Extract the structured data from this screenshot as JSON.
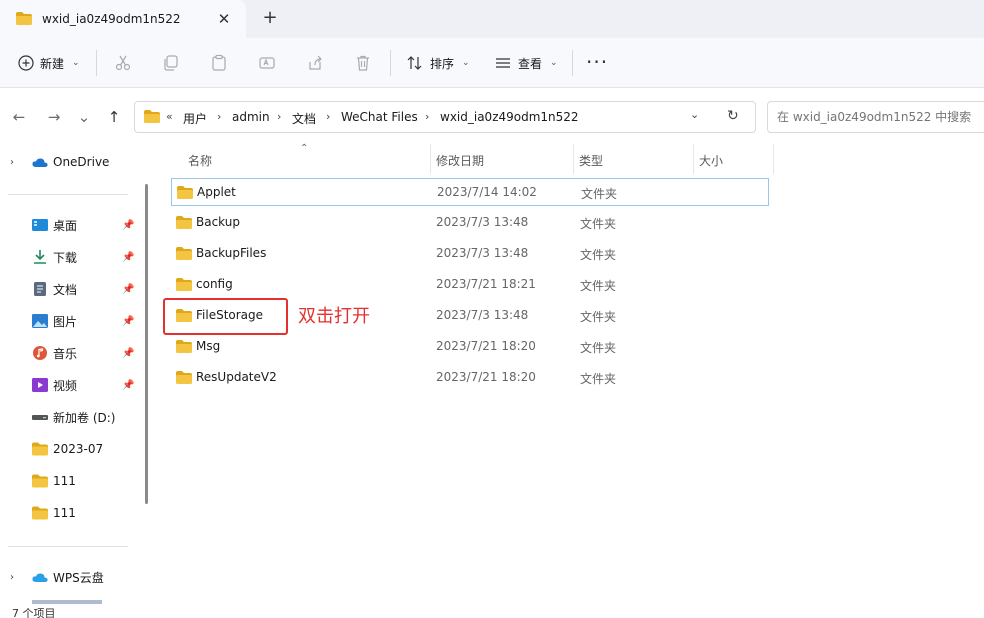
{
  "tab": {
    "title": "wxid_ia0z49odm1n522",
    "close_glyph": "✕",
    "new_glyph": "+"
  },
  "toolbar": {
    "new_label": "新建",
    "sort_label": "排序",
    "view_label": "查看",
    "more_glyph": "···",
    "icons": [
      "cut-icon",
      "copy-icon",
      "paste-icon",
      "rename-icon",
      "share-icon",
      "delete-icon"
    ]
  },
  "nav": {
    "back": "←",
    "forward": "→",
    "recent": "⌄",
    "up": "↑"
  },
  "address": {
    "overflow": "«",
    "crumbs": [
      "用户",
      "admin",
      "文档",
      "WeChat Files",
      "wxid_ia0z49odm1n522"
    ],
    "sep": "›"
  },
  "search": {
    "placeholder": "在 wxid_ia0z49odm1n522 中搜索"
  },
  "sidebar": {
    "onedrive": "OneDrive",
    "quick": [
      {
        "label": "桌面",
        "icon": "desktop-icon"
      },
      {
        "label": "下载",
        "icon": "download-icon"
      },
      {
        "label": "文档",
        "icon": "documents-icon"
      },
      {
        "label": "图片",
        "icon": "pictures-icon"
      },
      {
        "label": "音乐",
        "icon": "music-icon"
      },
      {
        "label": "视频",
        "icon": "video-icon"
      }
    ],
    "drive": "新加卷 (D:)",
    "folders": [
      "2023-07",
      "111",
      "111"
    ],
    "wps": "WPS云盘"
  },
  "columns": {
    "name": "名称",
    "date": "修改日期",
    "type": "类型",
    "size": "大小"
  },
  "files": [
    {
      "name": "Applet",
      "date": "2023/7/14 14:02",
      "type": "文件夹"
    },
    {
      "name": "Backup",
      "date": "2023/7/3 13:48",
      "type": "文件夹"
    },
    {
      "name": "BackupFiles",
      "date": "2023/7/3 13:48",
      "type": "文件夹"
    },
    {
      "name": "config",
      "date": "2023/7/21 18:21",
      "type": "文件夹"
    },
    {
      "name": "FileStorage",
      "date": "2023/7/3 13:48",
      "type": "文件夹"
    },
    {
      "name": "Msg",
      "date": "2023/7/21 18:20",
      "type": "文件夹"
    },
    {
      "name": "ResUpdateV2",
      "date": "2023/7/21 18:20",
      "type": "文件夹"
    }
  ],
  "annotation": "双击打开",
  "status": {
    "count": "7 个项目"
  },
  "colors": {
    "folder": "#f4c542",
    "folder_dark": "#e0a818",
    "highlight": "#e33030",
    "selection": "#9cc6e8"
  }
}
